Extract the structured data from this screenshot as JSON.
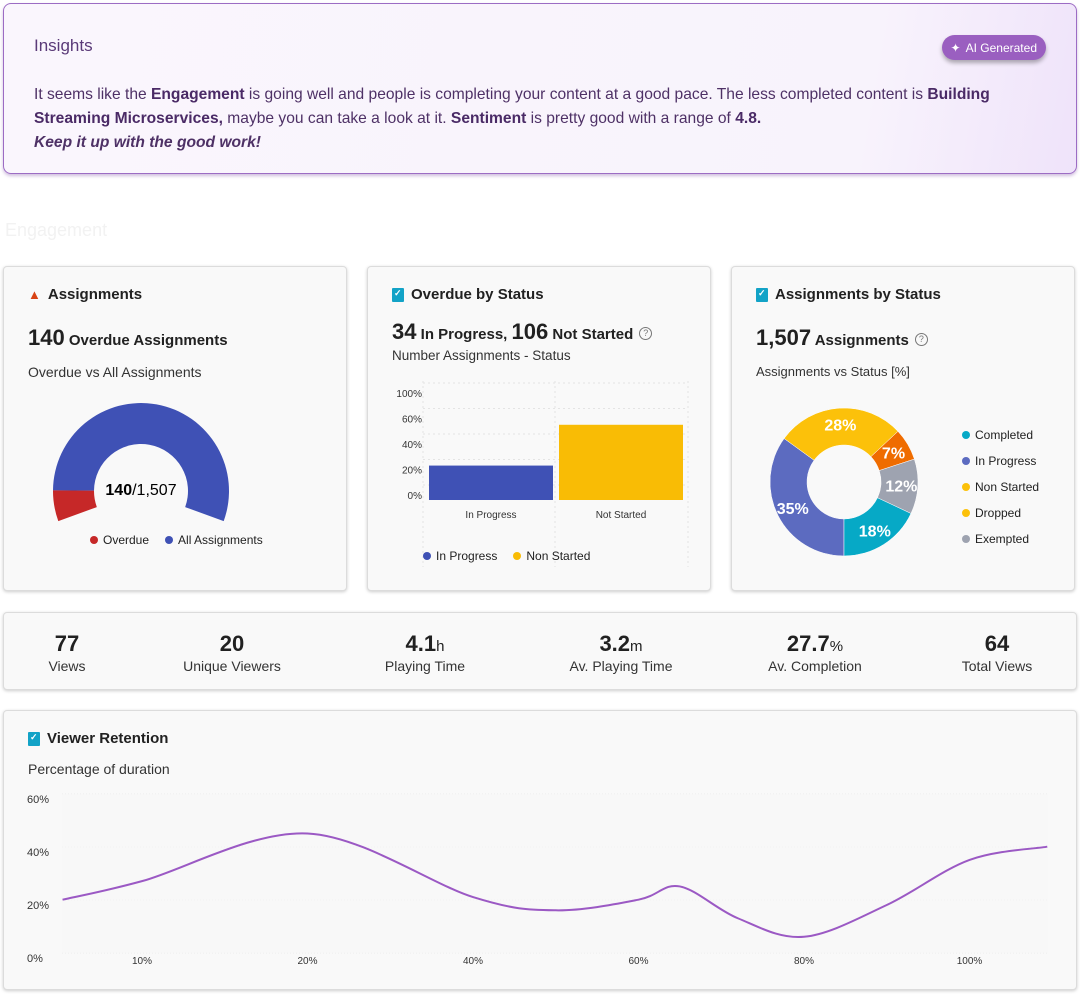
{
  "insights": {
    "title": "Insights",
    "badge": "AI Generated",
    "segments": [
      "It seems like the ",
      "Engagement",
      " is going well and people is completing your content at a good pace. The less completed content is ",
      "Building Streaming Microservices,",
      " maybe you can take a look at it. ",
      "Sentiment",
      " is pretty good with a range of ",
      "4.8."
    ],
    "closing": "Keep it up with the good work!"
  },
  "section_title": "Engagement",
  "assignments_card": {
    "title": "Assignments",
    "count": "140",
    "count_label": "Overdue Assignments",
    "subtitle": "Overdue vs All Assignments",
    "gauge_value": "140",
    "gauge_total": "/1,507",
    "legend": [
      "Overdue",
      "All Assignments"
    ]
  },
  "overdue_card": {
    "title": "Overdue by Status",
    "n1": "34",
    "l1": "In Progress,",
    "n2": "106",
    "l2": "Not Started",
    "subtitle": "Number Assignments - Status",
    "legend": [
      "In Progress",
      "Non Started"
    ]
  },
  "status_card": {
    "title": "Assignments by Status",
    "count": "1,507",
    "count_label": "Assignments",
    "subtitle": "Assignments vs Status [%]",
    "legend": [
      "Completed",
      "In Progress",
      "Non Started",
      "Dropped",
      "Exempted"
    ]
  },
  "stats": [
    {
      "value": "77",
      "unit": "",
      "label": "Views"
    },
    {
      "value": "20",
      "unit": "",
      "label": "Unique Viewers"
    },
    {
      "value": "4.1",
      "unit": "h",
      "label": "Playing Time"
    },
    {
      "value": "3.2",
      "unit": "m",
      "label": "Av. Playing Time"
    },
    {
      "value": "27.7",
      "unit": "%",
      "label": "Av. Completion"
    },
    {
      "value": "64",
      "unit": "",
      "label": "Total Views"
    }
  ],
  "retention_card": {
    "title": "Viewer Retention",
    "subtitle": "Percentage of duration"
  },
  "colors": {
    "overdue": "#c62828",
    "all": "#3f51b5",
    "in_progress_bar": "#3f51b5",
    "not_started_bar": "#f9bc05",
    "completed": "#06a9c6",
    "in_progress": "#5c6bc0",
    "non_started": "#fcc10a",
    "dropped": "#ef6c00",
    "exempted": "#9ea3b0",
    "line": "#9b59c4"
  },
  "chart_data": [
    {
      "type": "gauge",
      "title": "Overdue vs All Assignments",
      "value": 140,
      "total": 1507,
      "series": [
        "Overdue",
        "All Assignments"
      ]
    },
    {
      "type": "bar",
      "title": "Number Assignments - Status",
      "categories": [
        "In Progress",
        "Not Started"
      ],
      "values": [
        27,
        59
      ],
      "yticks": [
        "0%",
        "20%",
        "40%",
        "60%",
        "100%"
      ],
      "legend": [
        "In Progress",
        "Non Started"
      ]
    },
    {
      "type": "pie",
      "title": "Assignments vs Status [%]",
      "slices": [
        {
          "label": "In Progress",
          "value": 35,
          "text": "35%"
        },
        {
          "label": "Non Started",
          "value": 28,
          "text": "28%"
        },
        {
          "label": "Dropped",
          "value": 7,
          "text": "7%"
        },
        {
          "label": "Exempted",
          "value": 12,
          "text": "12%"
        },
        {
          "label": "Completed",
          "value": 18,
          "text": "18%"
        }
      ]
    },
    {
      "type": "line",
      "title": "Viewer Retention",
      "ylabel": "Percentage of duration",
      "xticks": [
        "10%",
        "20%",
        "40%",
        "60%",
        "80%",
        "100%"
      ],
      "yticks": [
        "0%",
        "20%",
        "40%",
        "60%"
      ],
      "ylim": [
        0,
        60
      ],
      "x": [
        -0.48,
        0,
        1,
        2,
        2.5,
        3,
        3.25,
        3.6,
        4,
        4.5,
        5,
        5.47
      ],
      "y": [
        22,
        29,
        47,
        23,
        18,
        22,
        27,
        15,
        8,
        20,
        37,
        42
      ]
    }
  ]
}
